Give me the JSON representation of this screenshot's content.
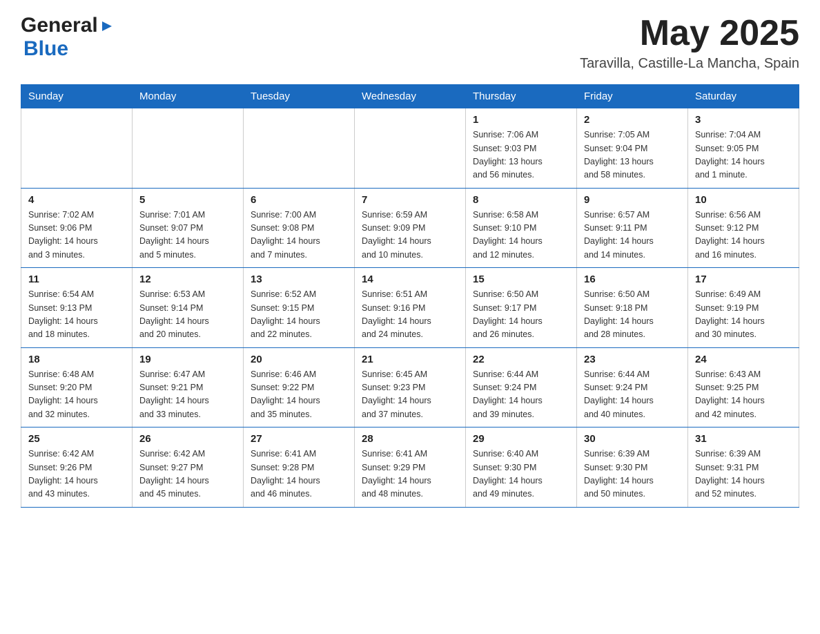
{
  "header": {
    "logo_general": "General",
    "logo_blue": "Blue",
    "month_title": "May 2025",
    "location": "Taravilla, Castille-La Mancha, Spain"
  },
  "weekdays": [
    "Sunday",
    "Monday",
    "Tuesday",
    "Wednesday",
    "Thursday",
    "Friday",
    "Saturday"
  ],
  "weeks": [
    [
      {
        "day": "",
        "info": ""
      },
      {
        "day": "",
        "info": ""
      },
      {
        "day": "",
        "info": ""
      },
      {
        "day": "",
        "info": ""
      },
      {
        "day": "1",
        "info": "Sunrise: 7:06 AM\nSunset: 9:03 PM\nDaylight: 13 hours\nand 56 minutes."
      },
      {
        "day": "2",
        "info": "Sunrise: 7:05 AM\nSunset: 9:04 PM\nDaylight: 13 hours\nand 58 minutes."
      },
      {
        "day": "3",
        "info": "Sunrise: 7:04 AM\nSunset: 9:05 PM\nDaylight: 14 hours\nand 1 minute."
      }
    ],
    [
      {
        "day": "4",
        "info": "Sunrise: 7:02 AM\nSunset: 9:06 PM\nDaylight: 14 hours\nand 3 minutes."
      },
      {
        "day": "5",
        "info": "Sunrise: 7:01 AM\nSunset: 9:07 PM\nDaylight: 14 hours\nand 5 minutes."
      },
      {
        "day": "6",
        "info": "Sunrise: 7:00 AM\nSunset: 9:08 PM\nDaylight: 14 hours\nand 7 minutes."
      },
      {
        "day": "7",
        "info": "Sunrise: 6:59 AM\nSunset: 9:09 PM\nDaylight: 14 hours\nand 10 minutes."
      },
      {
        "day": "8",
        "info": "Sunrise: 6:58 AM\nSunset: 9:10 PM\nDaylight: 14 hours\nand 12 minutes."
      },
      {
        "day": "9",
        "info": "Sunrise: 6:57 AM\nSunset: 9:11 PM\nDaylight: 14 hours\nand 14 minutes."
      },
      {
        "day": "10",
        "info": "Sunrise: 6:56 AM\nSunset: 9:12 PM\nDaylight: 14 hours\nand 16 minutes."
      }
    ],
    [
      {
        "day": "11",
        "info": "Sunrise: 6:54 AM\nSunset: 9:13 PM\nDaylight: 14 hours\nand 18 minutes."
      },
      {
        "day": "12",
        "info": "Sunrise: 6:53 AM\nSunset: 9:14 PM\nDaylight: 14 hours\nand 20 minutes."
      },
      {
        "day": "13",
        "info": "Sunrise: 6:52 AM\nSunset: 9:15 PM\nDaylight: 14 hours\nand 22 minutes."
      },
      {
        "day": "14",
        "info": "Sunrise: 6:51 AM\nSunset: 9:16 PM\nDaylight: 14 hours\nand 24 minutes."
      },
      {
        "day": "15",
        "info": "Sunrise: 6:50 AM\nSunset: 9:17 PM\nDaylight: 14 hours\nand 26 minutes."
      },
      {
        "day": "16",
        "info": "Sunrise: 6:50 AM\nSunset: 9:18 PM\nDaylight: 14 hours\nand 28 minutes."
      },
      {
        "day": "17",
        "info": "Sunrise: 6:49 AM\nSunset: 9:19 PM\nDaylight: 14 hours\nand 30 minutes."
      }
    ],
    [
      {
        "day": "18",
        "info": "Sunrise: 6:48 AM\nSunset: 9:20 PM\nDaylight: 14 hours\nand 32 minutes."
      },
      {
        "day": "19",
        "info": "Sunrise: 6:47 AM\nSunset: 9:21 PM\nDaylight: 14 hours\nand 33 minutes."
      },
      {
        "day": "20",
        "info": "Sunrise: 6:46 AM\nSunset: 9:22 PM\nDaylight: 14 hours\nand 35 minutes."
      },
      {
        "day": "21",
        "info": "Sunrise: 6:45 AM\nSunset: 9:23 PM\nDaylight: 14 hours\nand 37 minutes."
      },
      {
        "day": "22",
        "info": "Sunrise: 6:44 AM\nSunset: 9:24 PM\nDaylight: 14 hours\nand 39 minutes."
      },
      {
        "day": "23",
        "info": "Sunrise: 6:44 AM\nSunset: 9:24 PM\nDaylight: 14 hours\nand 40 minutes."
      },
      {
        "day": "24",
        "info": "Sunrise: 6:43 AM\nSunset: 9:25 PM\nDaylight: 14 hours\nand 42 minutes."
      }
    ],
    [
      {
        "day": "25",
        "info": "Sunrise: 6:42 AM\nSunset: 9:26 PM\nDaylight: 14 hours\nand 43 minutes."
      },
      {
        "day": "26",
        "info": "Sunrise: 6:42 AM\nSunset: 9:27 PM\nDaylight: 14 hours\nand 45 minutes."
      },
      {
        "day": "27",
        "info": "Sunrise: 6:41 AM\nSunset: 9:28 PM\nDaylight: 14 hours\nand 46 minutes."
      },
      {
        "day": "28",
        "info": "Sunrise: 6:41 AM\nSunset: 9:29 PM\nDaylight: 14 hours\nand 48 minutes."
      },
      {
        "day": "29",
        "info": "Sunrise: 6:40 AM\nSunset: 9:30 PM\nDaylight: 14 hours\nand 49 minutes."
      },
      {
        "day": "30",
        "info": "Sunrise: 6:39 AM\nSunset: 9:30 PM\nDaylight: 14 hours\nand 50 minutes."
      },
      {
        "day": "31",
        "info": "Sunrise: 6:39 AM\nSunset: 9:31 PM\nDaylight: 14 hours\nand 52 minutes."
      }
    ]
  ]
}
